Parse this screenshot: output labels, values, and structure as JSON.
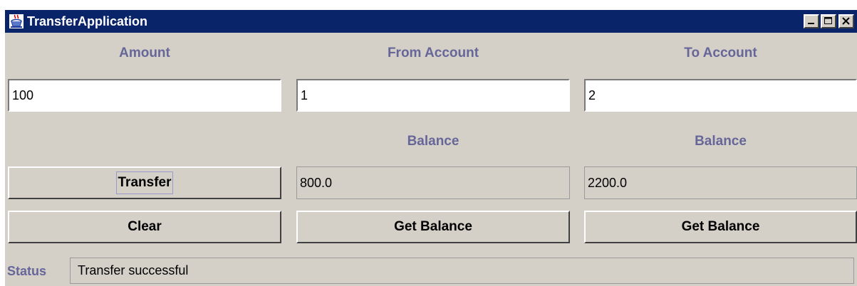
{
  "window": {
    "title": "TransferApplication",
    "icon": "java-cup-icon"
  },
  "labels": {
    "amount": "Amount",
    "from_account": "From Account",
    "to_account": "To Account",
    "from_balance": "Balance",
    "to_balance": "Balance",
    "status": "Status"
  },
  "inputs": {
    "amount": "100",
    "from_account": "1",
    "to_account": "2"
  },
  "balances": {
    "from": "800.0",
    "to": "2200.0"
  },
  "buttons": {
    "transfer": "Transfer",
    "clear": "Clear",
    "from_get_balance": "Get Balance",
    "to_get_balance": "Get Balance"
  },
  "status": {
    "text": "Transfer successful"
  },
  "colors": {
    "title_bar": "#0a246a",
    "label": "#666699",
    "window_bg": "#d4d0c8"
  }
}
